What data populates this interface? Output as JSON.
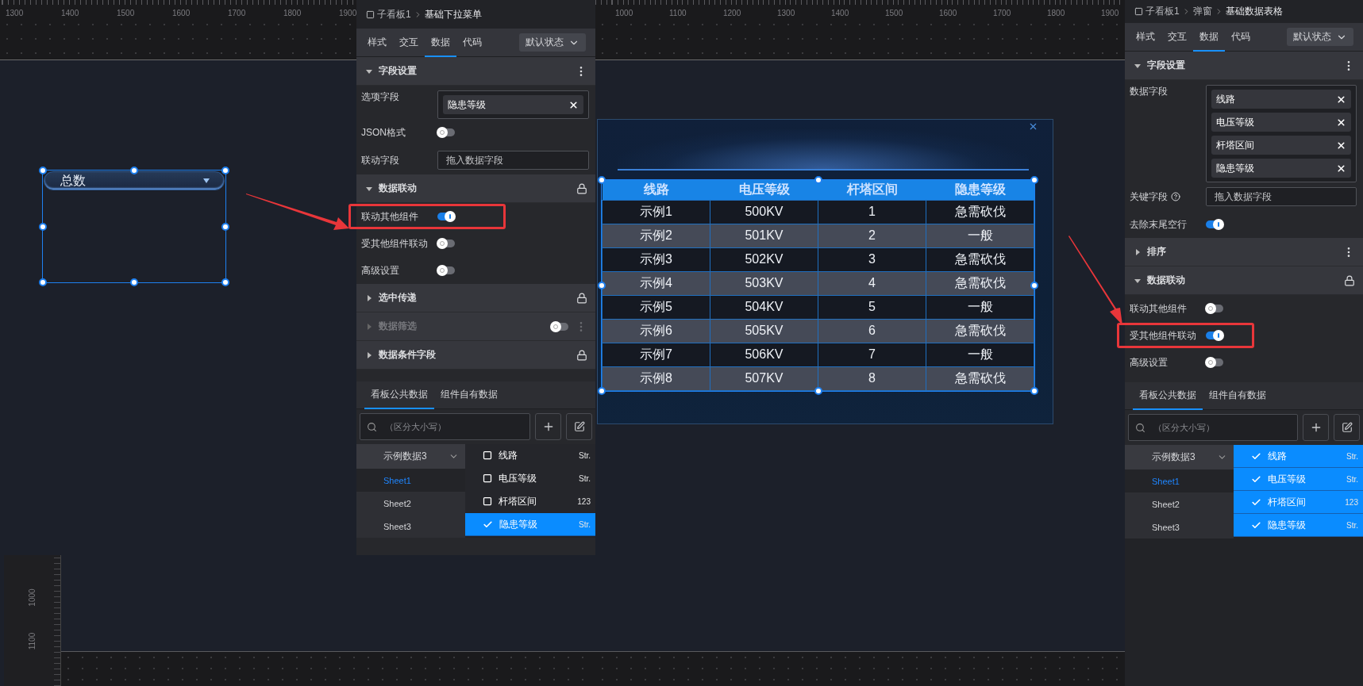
{
  "left_canvas": {
    "ruler_labels": [
      "1300",
      "1400",
      "1500",
      "1600",
      "1700",
      "1800",
      "1900"
    ],
    "dropdown": {
      "value": "总数",
      "selected": true
    },
    "side_ruler_labels": [
      "1000",
      "1100"
    ]
  },
  "left_panel": {
    "breadcrumb": [
      "子看板1",
      "基础下拉菜单"
    ],
    "tabs": [
      {
        "label": "样式",
        "selected": false
      },
      {
        "label": "交互",
        "selected": false
      },
      {
        "label": "数据",
        "selected": true
      },
      {
        "label": "代码",
        "selected": false
      }
    ],
    "state_select": "默认状态",
    "sections": [
      {
        "title": "字段设置",
        "expanded": true,
        "kind": "menu",
        "rows": [
          {
            "kind": "tags",
            "label": "选项字段",
            "tags": [
              "隐患等级"
            ]
          },
          {
            "kind": "switch",
            "label": "JSON格式",
            "on": false
          },
          {
            "kind": "dropzone",
            "label": "联动字段",
            "placeholder": "拖入数据字段"
          }
        ]
      },
      {
        "title": "数据联动",
        "expanded": true,
        "kind": "lock",
        "rows": [
          {
            "kind": "switch",
            "label": "联动其他组件",
            "on": true,
            "annotated": true
          },
          {
            "kind": "switch",
            "label": "受其他组件联动",
            "on": false
          },
          {
            "kind": "switch",
            "label": "高级设置",
            "on": false
          }
        ]
      },
      {
        "title": "选中传递",
        "expanded": false,
        "kind": "lock"
      },
      {
        "title": "数据筛选",
        "expanded": false,
        "kind": "switch_menu",
        "disabled": true,
        "on": false
      },
      {
        "title": "数据条件字段",
        "expanded": false,
        "kind": "lock"
      }
    ],
    "data_tabs": [
      {
        "label": "看板公共数据",
        "selected": true
      },
      {
        "label": "组件自有数据",
        "selected": false
      }
    ],
    "search": {
      "placeholder": "（区分大小写）"
    },
    "dataset": "示例数据3",
    "sheets": [
      {
        "label": "Sheet1",
        "selected": true
      },
      {
        "label": "Sheet2",
        "selected": false
      },
      {
        "label": "Sheet3",
        "selected": false
      }
    ],
    "fields": [
      {
        "name": "线路",
        "type": "Str.",
        "checked": false
      },
      {
        "name": "电压等级",
        "type": "Str.",
        "checked": false
      },
      {
        "name": "杆塔区间",
        "type": "123",
        "checked": false
      },
      {
        "name": "隐患等级",
        "type": "Str.",
        "checked": true
      }
    ]
  },
  "center_canvas": {
    "ruler_labels": [
      "1000",
      "1100",
      "1200",
      "1300",
      "1400",
      "1500",
      "1600",
      "1700",
      "1800",
      "1900"
    ],
    "table": {
      "selected": true,
      "columns": [
        "线路",
        "电压等级",
        "杆塔区间",
        "隐患等级"
      ],
      "rows": [
        [
          "示例1",
          "500KV",
          "1",
          "急需砍伐"
        ],
        [
          "示例2",
          "501KV",
          "2",
          "一般"
        ],
        [
          "示例3",
          "502KV",
          "3",
          "急需砍伐"
        ],
        [
          "示例4",
          "503KV",
          "4",
          "急需砍伐"
        ],
        [
          "示例5",
          "504KV",
          "5",
          "一般"
        ],
        [
          "示例6",
          "505KV",
          "6",
          "急需砍伐"
        ],
        [
          "示例7",
          "506KV",
          "7",
          "一般"
        ],
        [
          "示例8",
          "507KV",
          "8",
          "急需砍伐"
        ]
      ]
    }
  },
  "right_panel": {
    "breadcrumb": [
      "子看板1",
      "弹窗",
      "基础数据表格"
    ],
    "tabs": [
      {
        "label": "样式",
        "selected": false
      },
      {
        "label": "交互",
        "selected": false
      },
      {
        "label": "数据",
        "selected": true
      },
      {
        "label": "代码",
        "selected": false
      }
    ],
    "state_select": "默认状态",
    "sections": [
      {
        "title": "字段设置",
        "expanded": true,
        "kind": "menu",
        "rows": [
          {
            "kind": "tags",
            "label": "数据字段",
            "tags": [
              "线路",
              "电压等级",
              "杆塔区间",
              "隐患等级"
            ]
          },
          {
            "kind": "dropzone",
            "label": "关键字段",
            "placeholder": "拖入数据字段",
            "help": true
          },
          {
            "kind": "switch",
            "label": "去除末尾空行",
            "on": true
          }
        ]
      },
      {
        "title": "排序",
        "expanded": false,
        "kind": "menu"
      },
      {
        "title": "数据联动",
        "expanded": true,
        "kind": "lock",
        "rows": [
          {
            "kind": "switch",
            "label": "联动其他组件",
            "on": false
          },
          {
            "kind": "switch",
            "label": "受其他组件联动",
            "on": true,
            "annotated": true
          },
          {
            "kind": "switch",
            "label": "高级设置",
            "on": false
          }
        ]
      }
    ],
    "data_tabs": [
      {
        "label": "看板公共数据",
        "selected": true
      },
      {
        "label": "组件自有数据",
        "selected": false
      }
    ],
    "search": {
      "placeholder": "（区分大小写）"
    },
    "dataset": "示例数据3",
    "sheets": [
      {
        "label": "Sheet1",
        "selected": true
      },
      {
        "label": "Sheet2",
        "selected": false
      },
      {
        "label": "Sheet3",
        "selected": false
      }
    ],
    "fields": [
      {
        "name": "线路",
        "type": "Str.",
        "checked": true
      },
      {
        "name": "电压等级",
        "type": "Str.",
        "checked": true
      },
      {
        "name": "杆塔区间",
        "type": "123",
        "checked": true
      },
      {
        "name": "隐患等级",
        "type": "Str.",
        "checked": true
      }
    ]
  }
}
